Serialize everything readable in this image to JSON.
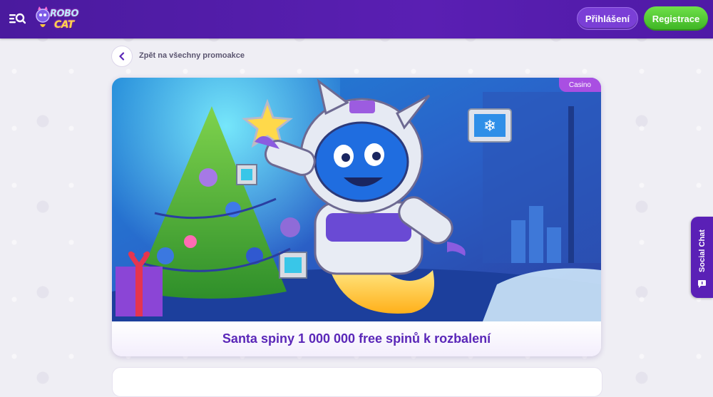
{
  "header": {
    "logo_line1": "ROBO",
    "logo_line2": "CAT",
    "login_label": "Přihlášení",
    "register_label": "Registrace",
    "menu_icon": "menu-search-icon"
  },
  "breadcrumb": {
    "back_label": "Zpět na všechny promoakce",
    "back_icon": "chevron-left-icon"
  },
  "promo": {
    "badge": "Casino",
    "title": "Santa spiny 1 000 000 free spinů k rozbalení"
  },
  "social_chat": {
    "label": "Social Chat",
    "icon": "chat-icon"
  },
  "colors": {
    "header_bg": "#4f1aa6",
    "register_green": "#3db423",
    "login_purple": "#7a3fd6",
    "title_purple": "#5a27b8",
    "badge_purple": "#a94fe2"
  }
}
